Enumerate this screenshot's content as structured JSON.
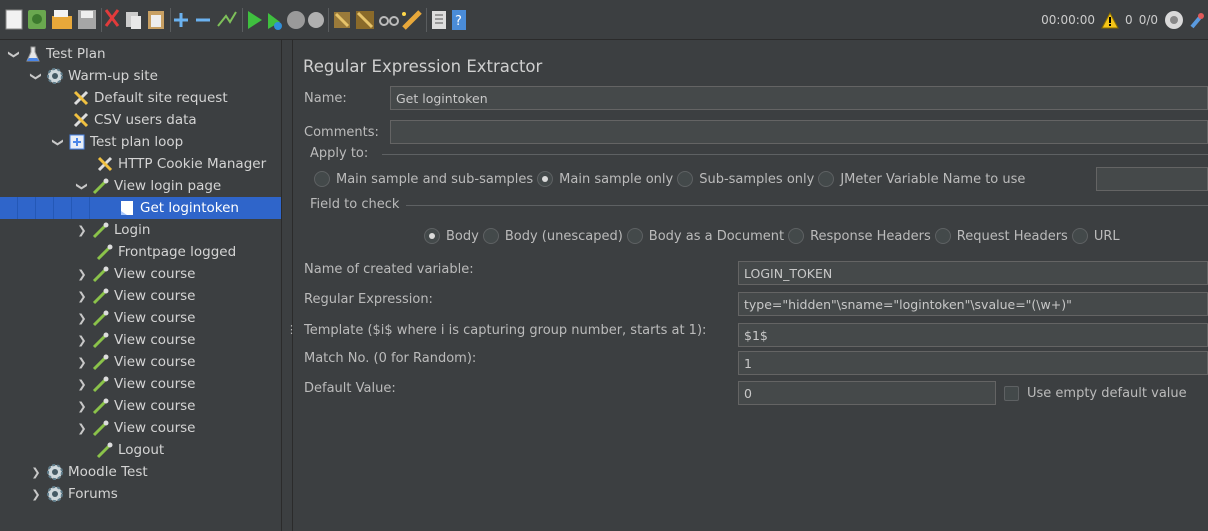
{
  "toolbar": {
    "timer": "00:00:00",
    "warning_count": "0",
    "thread_count": "0/0",
    "buttons": [
      "new-icon",
      "templates-icon",
      "open-icon",
      "save-icon",
      "cut-icon",
      "copy-icon",
      "paste-icon",
      "expand-icon",
      "collapse-icon",
      "toggle-icon",
      "start-icon",
      "start-no-pauses-icon",
      "stop-icon",
      "shutdown-icon",
      "clear-icon",
      "clear-all-icon",
      "search-icon",
      "reset-search-icon",
      "function-helper-icon",
      "help-icon"
    ]
  },
  "tree": {
    "items": [
      {
        "label": "Test Plan"
      },
      {
        "label": "Warm-up site"
      },
      {
        "label": "Default site request"
      },
      {
        "label": "CSV users data"
      },
      {
        "label": "Test plan loop"
      },
      {
        "label": "HTTP Cookie Manager"
      },
      {
        "label": "View login page"
      },
      {
        "label": "Get logintoken"
      },
      {
        "label": "Login"
      },
      {
        "label": "Frontpage logged"
      },
      {
        "label": "View course"
      },
      {
        "label": "View course"
      },
      {
        "label": "View course"
      },
      {
        "label": "View course"
      },
      {
        "label": "View course"
      },
      {
        "label": "View course"
      },
      {
        "label": "View course"
      },
      {
        "label": "View course"
      },
      {
        "label": "Logout"
      },
      {
        "label": "Moodle Test"
      },
      {
        "label": "Forums"
      }
    ]
  },
  "panel": {
    "title": "Regular Expression Extractor",
    "name_label": "Name:",
    "name_value": "Get logintoken",
    "comments_label": "Comments:",
    "comments_value": "",
    "apply_to": {
      "label": "Apply to:",
      "options": [
        "Main sample and sub-samples",
        "Main sample only",
        "Sub-samples only",
        "JMeter Variable Name to use"
      ],
      "selected": "Main sample only",
      "variable_value": ""
    },
    "field_to_check": {
      "label": "Field to check",
      "options": [
        "Body",
        "Body (unescaped)",
        "Body as a Document",
        "Response Headers",
        "Request Headers",
        "URL"
      ],
      "selected": "Body"
    },
    "fields": {
      "var_label": "Name of created variable:",
      "var_value": "LOGIN_TOKEN",
      "regex_label": "Regular Expression:",
      "regex_value": "type=\"hidden\"\\sname=\"logintoken\"\\svalue=\"(\\w+)\"",
      "template_label": "Template ($i$ where i is capturing group number, starts at 1):",
      "template_value": "$1$",
      "match_label": "Match No. (0 for Random):",
      "match_value": "1",
      "default_label": "Default Value:",
      "default_value": "0",
      "empty_default_label": "Use empty default value"
    }
  }
}
